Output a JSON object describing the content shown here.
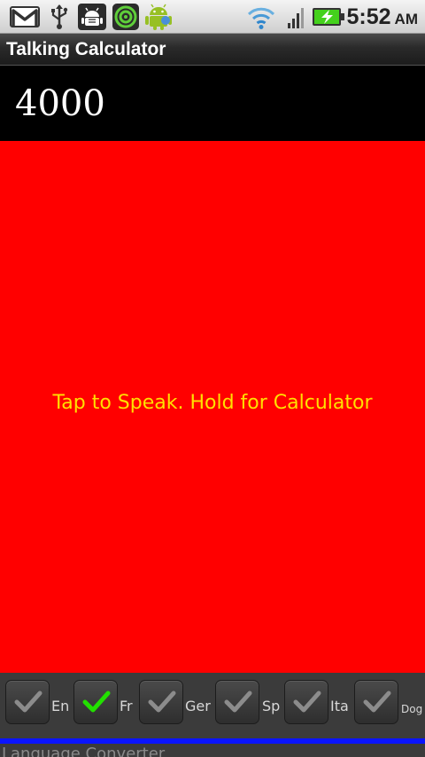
{
  "status_bar": {
    "time": "5:52",
    "ampm": "AM",
    "icons": [
      "gmail-icon",
      "usb-icon",
      "usb-debugging-icon",
      "lookout-icon",
      "android-icon",
      "wifi-icon",
      "signal-icon",
      "battery-charging-icon"
    ]
  },
  "app": {
    "title": "Talking Calculator"
  },
  "display": {
    "value": "4000"
  },
  "tap_area": {
    "hint": "Tap to Speak. Hold for Calculator",
    "background_color": "#ff0000",
    "hint_color": "#ffe000"
  },
  "languages": [
    {
      "label": "En",
      "checked": false
    },
    {
      "label": "Fr",
      "checked": true
    },
    {
      "label": "Ger",
      "checked": false
    },
    {
      "label": "Sp",
      "checked": false
    },
    {
      "label": "Ita",
      "checked": false
    },
    {
      "label": "Dog",
      "checked": false
    }
  ],
  "footer": {
    "text": "Language Converter"
  },
  "colors": {
    "accent_line": "#0a14ff",
    "check_on": "#22e000",
    "check_off": "#8c8c8c"
  }
}
